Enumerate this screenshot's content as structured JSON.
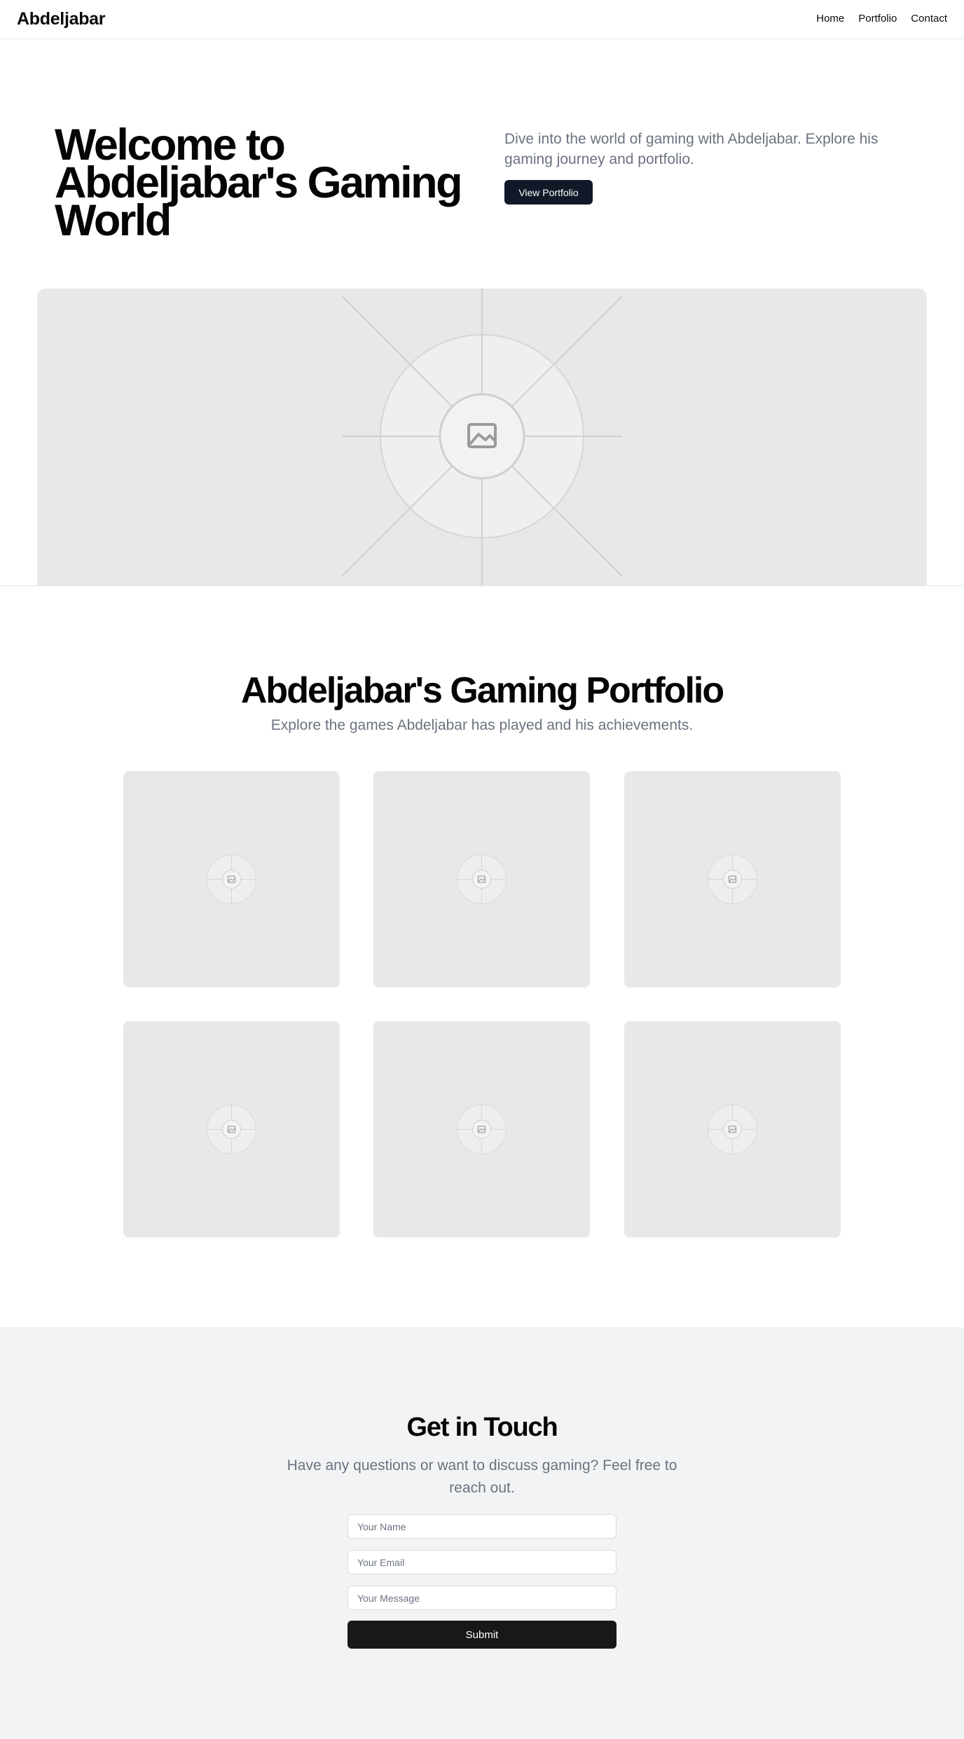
{
  "header": {
    "brand": "Abdeljabar",
    "nav": [
      "Home",
      "Portfolio",
      "Contact"
    ]
  },
  "hero": {
    "title": "Welcome to Abdeljabar's Gaming World",
    "description": "Dive into the world of gaming with Abdeljabar. Explore his gaming journey and portfolio.",
    "button_label": "View Portfolio",
    "image_icon": "image-placeholder-icon"
  },
  "portfolio": {
    "title": "Abdeljabar's Gaming Portfolio",
    "subtitle": "Explore the games Abdeljabar has played and his achievements.",
    "card_icon": "image-placeholder-icon",
    "card_count": 6
  },
  "contact": {
    "title": "Get in Touch",
    "subtitle": "Have any questions or want to discuss gaming? Feel free to reach out.",
    "name_placeholder": "Your Name",
    "email_placeholder": "Your Email",
    "message_placeholder": "Your Message",
    "submit_label": "Submit"
  },
  "colors": {
    "button_dark": "#111827",
    "muted_text": "#6b7280",
    "placeholder_bg": "#e8e8e8",
    "contact_bg": "#f2f3f5"
  }
}
